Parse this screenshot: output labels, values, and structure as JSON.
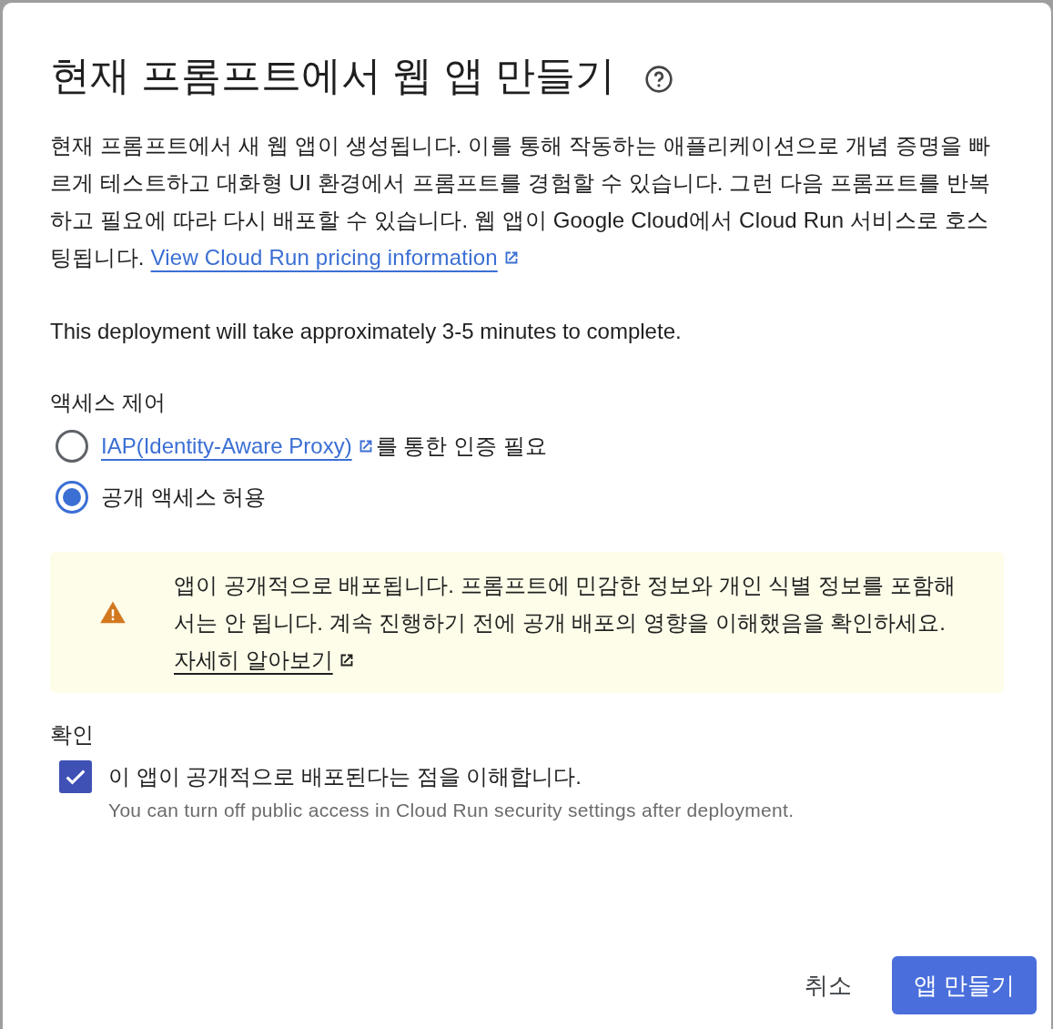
{
  "dialog": {
    "title": "현재 프롬프트에서 웹 앱 만들기",
    "description": {
      "text": "현재 프롬프트에서 새 웹 앱이 생성됩니다. 이를 통해 작동하는 애플리케이션으로 개념 증명을 빠르게 테스트하고 대화형 UI 환경에서 프롬프트를 경험할 수 있습니다. 그런 다음 프롬프트를 반복하고 필요에 따라 다시 배포할 수 있습니다. 웹 앱이 Google Cloud에서 Cloud Run 서비스로 호스팅됩니다. ",
      "link": "View Cloud Run pricing information"
    },
    "note": "This deployment will take approximately 3-5 minutes to complete.",
    "access_control": {
      "heading": "액세스 제어",
      "options": [
        {
          "link": "IAP(Identity-Aware Proxy)",
          "text": "를 통한 인증 필요",
          "selected": false
        },
        {
          "text": "공개 액세스 허용",
          "selected": true
        }
      ]
    },
    "warning": {
      "text": "앱이 공개적으로 배포됩니다. 프롬프트에 민감한 정보와 개인 식별 정보를 포함해서는 안 됩니다. 계속 진행하기 전에 공개 배포의 영향을 이해했음을 확인하세요. ",
      "link": "자세히 알아보기"
    },
    "confirm": {
      "heading": "확인",
      "checkbox": {
        "label": "이 앱이 공개적으로 배포된다는 점을 이해합니다.",
        "hint": "You can turn off public access in Cloud Run security settings after deployment.",
        "checked": true
      }
    },
    "buttons": [
      {
        "label": "취소",
        "kind": "text"
      },
      {
        "label": "앱 만들기",
        "kind": "primary"
      }
    ]
  }
}
